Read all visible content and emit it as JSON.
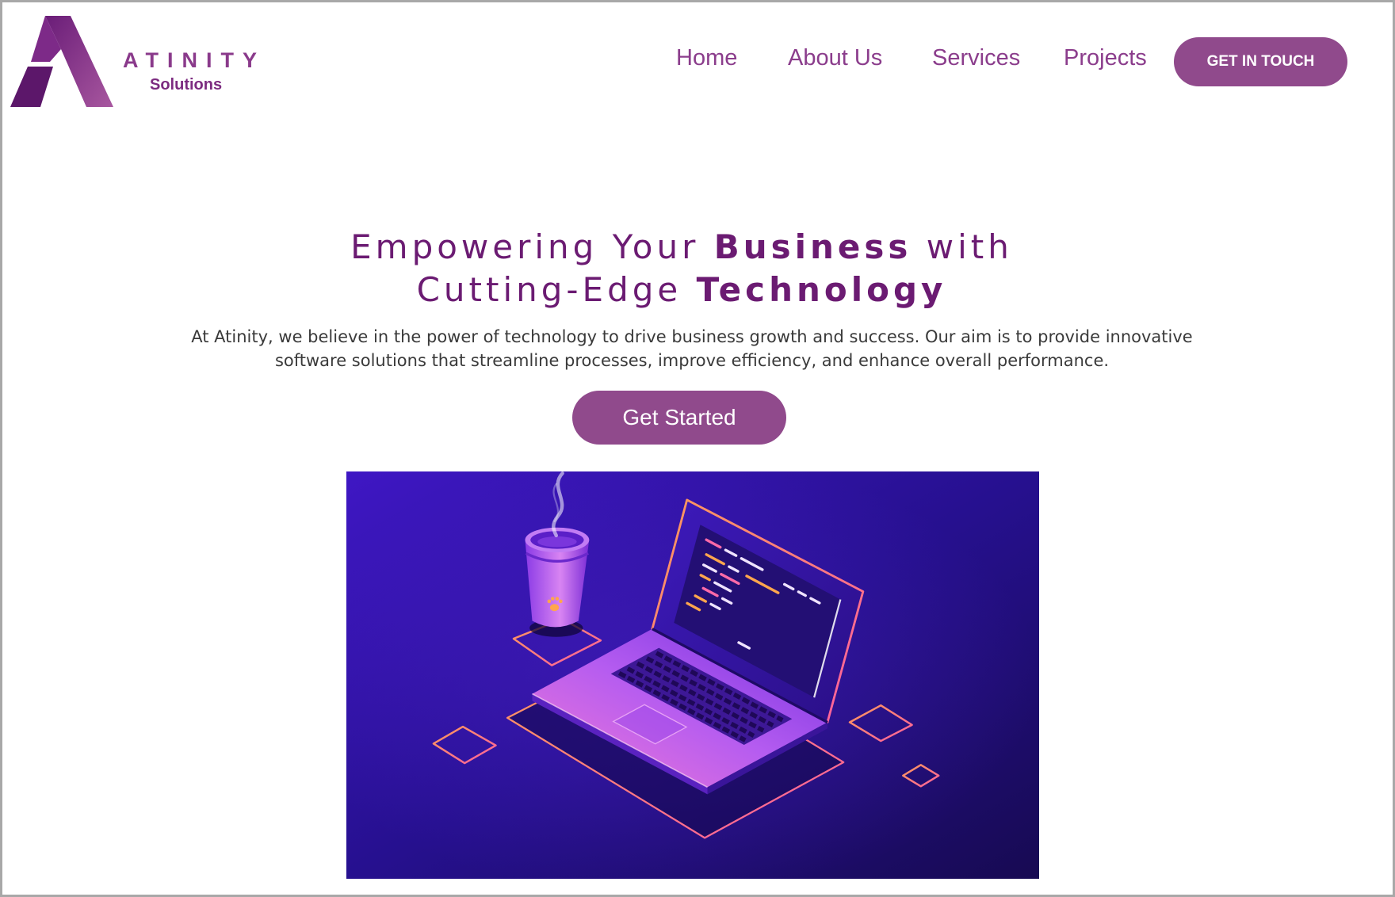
{
  "brand": {
    "name": "ATINITY",
    "tagline": "Solutions",
    "logo_icon": "atinity-logo-icon"
  },
  "nav": {
    "items": [
      {
        "label": "Home"
      },
      {
        "label": "About Us"
      },
      {
        "label": "Services"
      },
      {
        "label": "Projects"
      }
    ],
    "cta_label": "GET IN TOUCH"
  },
  "hero": {
    "title": {
      "line1_lead": "Empowering Your ",
      "line1_bold": "Business",
      "line1_tail": " with",
      "line2_lead": "Cutting-Edge ",
      "line2_bold": "Technology"
    },
    "description": {
      "line1": "At Atinity, we believe in the power of technology to drive business growth and success. Our aim is to provide innovative",
      "line2": "software solutions that streamline processes, improve efficiency, and enhance overall performance."
    },
    "cta_label": "Get Started"
  },
  "colors": {
    "accent": "#904a8c",
    "headline": "#6b1b72",
    "nav_text": "#8b3d8c",
    "body_text": "#3a3a3a"
  }
}
